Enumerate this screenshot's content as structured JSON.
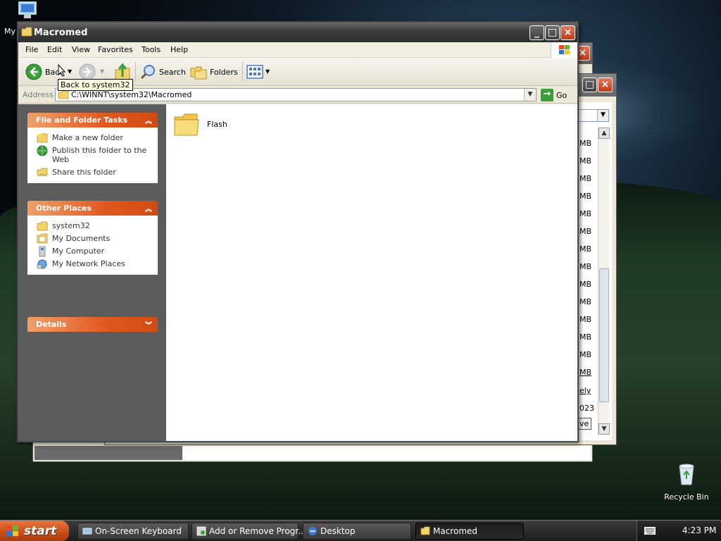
{
  "desktop": {
    "my_computer_label": "My",
    "recycle_bin_label": "Recycle Bin"
  },
  "background_window": {
    "sizes": [
      "MB",
      "MB",
      "MB",
      "MB",
      "MB",
      "MB",
      "MB",
      "MB",
      "MB",
      "MB",
      "MB",
      "MB",
      "MB",
      "MB"
    ],
    "link_text": "ely",
    "number_text": "023",
    "button_text": "ve"
  },
  "window": {
    "title": "Macromed",
    "menu": [
      "File",
      "Edit",
      "View",
      "Favorites",
      "Tools",
      "Help"
    ],
    "toolbar": {
      "back": "Back",
      "search": "Search",
      "folders": "Folders"
    },
    "tooltip": "Back to system32",
    "address": {
      "label": "Address",
      "path": "C:\\WINNT\\system32\\Macromed",
      "go": "Go"
    },
    "tasks_panel": {
      "title": "File and Folder Tasks",
      "items": [
        "Make a new folder",
        "Publish this folder to the Web",
        "Share this folder"
      ]
    },
    "places_panel": {
      "title": "Other Places",
      "items": [
        "system32",
        "My Documents",
        "My Computer",
        "My Network Places"
      ]
    },
    "details_panel": {
      "title": "Details"
    },
    "files": [
      {
        "name": "Flash"
      }
    ]
  },
  "taskbar": {
    "start": "start",
    "tasks": [
      "On-Screen Keyboard",
      "Add or Remove Progr...",
      "Desktop",
      "Macromed"
    ],
    "clock": "4:23 PM"
  },
  "colors": {
    "panel_header": "#e1581f",
    "start_button": "#c74c16",
    "title_bar": "#3f3f3f"
  }
}
